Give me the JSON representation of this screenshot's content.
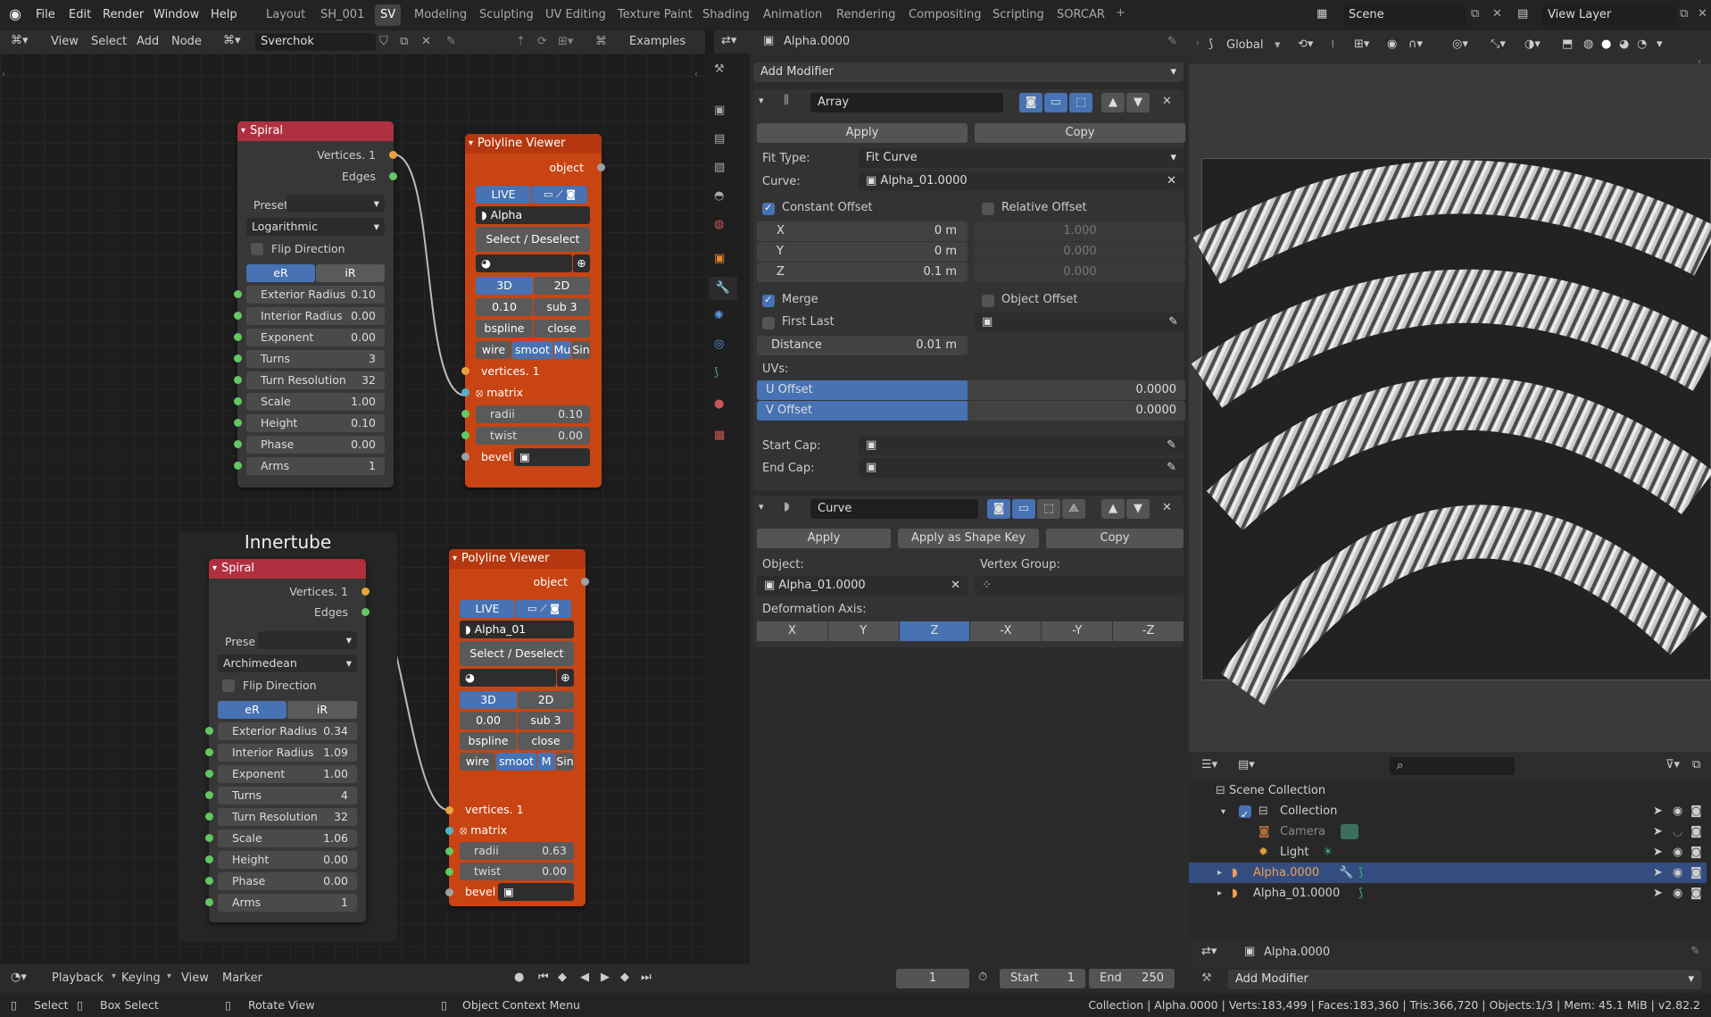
{
  "topbar": {
    "menus": [
      "File",
      "Edit",
      "Render",
      "Window",
      "Help"
    ],
    "workspaces": [
      "Layout",
      "SH_001",
      "SV",
      "Modeling",
      "Sculpting",
      "UV Editing",
      "Texture Paint",
      "Shading",
      "Animation",
      "Rendering",
      "Compositing",
      "Scripting",
      "SORCAR"
    ],
    "active_workspace": "SV",
    "scene": "Scene",
    "view_layer": "View Layer"
  },
  "node_header": {
    "menus": [
      "View",
      "Select",
      "Add",
      "Node"
    ],
    "tree_name": "Sverchok",
    "examples": "Examples"
  },
  "frame_label": "Innertube",
  "spiral1": {
    "title": "Spiral",
    "out_vertices": "Vertices. 1",
    "out_edges": "Edges",
    "preset": "Preset",
    "mode": "Logarithmic",
    "flip": "Flip Direction",
    "er": "eR",
    "ir": "iR",
    "fields": [
      {
        "label": "Exterior Radius",
        "value": "0.10"
      },
      {
        "label": "Interior Radius",
        "value": "0.00"
      },
      {
        "label": "Exponent",
        "value": "0.00"
      },
      {
        "label": "Turns",
        "value": "3"
      },
      {
        "label": "Turn Resolution",
        "value": "32"
      },
      {
        "label": "Scale",
        "value": "1.00"
      },
      {
        "label": "Height",
        "value": "0.10"
      },
      {
        "label": "Phase",
        "value": "0.00"
      },
      {
        "label": "Arms",
        "value": "1"
      }
    ]
  },
  "spiral2": {
    "title": "Spiral",
    "out_vertices": "Vertices. 1",
    "out_edges": "Edges",
    "preset": "Prese",
    "mode": "Archimedean",
    "flip": "Flip Direction",
    "er": "eR",
    "ir": "iR",
    "fields": [
      {
        "label": "Exterior Radius",
        "value": "0.34"
      },
      {
        "label": "Interior Radius",
        "value": "1.09"
      },
      {
        "label": "Exponent",
        "value": "1.00"
      },
      {
        "label": "Turns",
        "value": "4"
      },
      {
        "label": "Turn Resolution",
        "value": "32"
      },
      {
        "label": "Scale",
        "value": "1.06"
      },
      {
        "label": "Height",
        "value": "0.00"
      },
      {
        "label": "Phase",
        "value": "0.00"
      },
      {
        "label": "Arms",
        "value": "1"
      }
    ]
  },
  "pv1": {
    "title": "Polyline Viewer",
    "object": "object",
    "live": "LIVE",
    "obj_name": "Alpha",
    "select": "Select / Deselect",
    "d3": "3D",
    "d2": "2D",
    "val": "0.10",
    "sub": "sub  3",
    "bspline": "bspline",
    "close": "close",
    "wire": "wire",
    "smooth": "smoot",
    "mu": "Mu",
    "sin": "Sin",
    "vertices": "vertices. 1",
    "matrix": "matrix",
    "radii_l": "radii",
    "radii_v": "0.10",
    "twist_l": "twist",
    "twist_v": "0.00",
    "bevel": "bevel"
  },
  "pv2": {
    "title": "Polyline Viewer",
    "object": "object",
    "live": "LIVE",
    "obj_name": "Alpha_01",
    "select": "Select / Deselect",
    "d3": "3D",
    "d2": "2D",
    "val": "0.00",
    "sub": "sub  3",
    "bspline": "bspline",
    "close": "close",
    "wire": "wire",
    "smooth": "smoot",
    "mu": "M",
    "sin": "Sin",
    "vertices": "vertices. 1",
    "matrix": "matrix",
    "radii_l": "radii",
    "radii_v": "0.63",
    "twist_l": "twist",
    "twist_v": "0.00",
    "bevel": "bevel"
  },
  "props": {
    "object_name": "Alpha.0000",
    "add_modifier": "Add Modifier",
    "array": {
      "name": "Array",
      "apply": "Apply",
      "copy": "Copy",
      "fit_type_label": "Fit Type:",
      "fit_type": "Fit Curve",
      "curve_label": "Curve:",
      "curve": "Alpha_01.0000",
      "const_offset": "Constant Offset",
      "rel_offset": "Relative Offset",
      "x_l": "X",
      "x_v": "0 m",
      "y_l": "Y",
      "y_v": "0 m",
      "z_l": "Z",
      "z_v": "0.1 m",
      "rx": "1.000",
      "ry": "0.000",
      "rz": "0.000",
      "merge": "Merge",
      "obj_offset": "Object Offset",
      "first_last": "First Last",
      "distance_l": "Distance",
      "distance_v": "0.01 m",
      "uvs": "UVs:",
      "u_l": "U Offset",
      "u_v": "0.0000",
      "v_l": "V Offset",
      "v_v": "0.0000",
      "start_cap": "Start Cap:",
      "end_cap": "End Cap:"
    },
    "curve": {
      "name": "Curve",
      "apply": "Apply",
      "apply_shape": "Apply as Shape Key",
      "copy": "Copy",
      "object_label": "Object:",
      "object": "Alpha_01.0000",
      "vgroup_label": "Vertex Group:",
      "deform_label": "Deformation Axis:",
      "axes": [
        "X",
        "Y",
        "Z",
        "-X",
        "-Y",
        "-Z"
      ],
      "active_axis": "Z"
    }
  },
  "viewport": {
    "orientation": "Global"
  },
  "outliner": {
    "scene_collection": "Scene Collection",
    "items": [
      {
        "name": "Collection"
      },
      {
        "name": "Camera"
      },
      {
        "name": "Light"
      },
      {
        "name": "Alpha.0000"
      },
      {
        "name": "Alpha_01.0000"
      }
    ]
  },
  "bottom_props": {
    "object_name": "Alpha.0000",
    "add_modifier": "Add Modifier"
  },
  "timeline": {
    "menus": [
      "Playback",
      "Keying",
      "View",
      "Marker"
    ],
    "frame": "1",
    "start_l": "Start",
    "start_v": "1",
    "end_l": "End",
    "end_v": "250"
  },
  "statusbar": {
    "select": "Select",
    "box_select": "Box Select",
    "rotate": "Rotate View",
    "ctx_menu": "Object Context Menu",
    "stats": "Collection | Alpha.0000 | Verts:183,499 | Faces:183,360 | Tris:366,720 | Objects:1/3 | Mem: 45.1 MiB | v2.82.2"
  },
  "colors": {
    "accent": "#4772b3",
    "spiral_header": "#b03040",
    "viewer_body": "#c84412",
    "selected_row": "#334d80"
  }
}
